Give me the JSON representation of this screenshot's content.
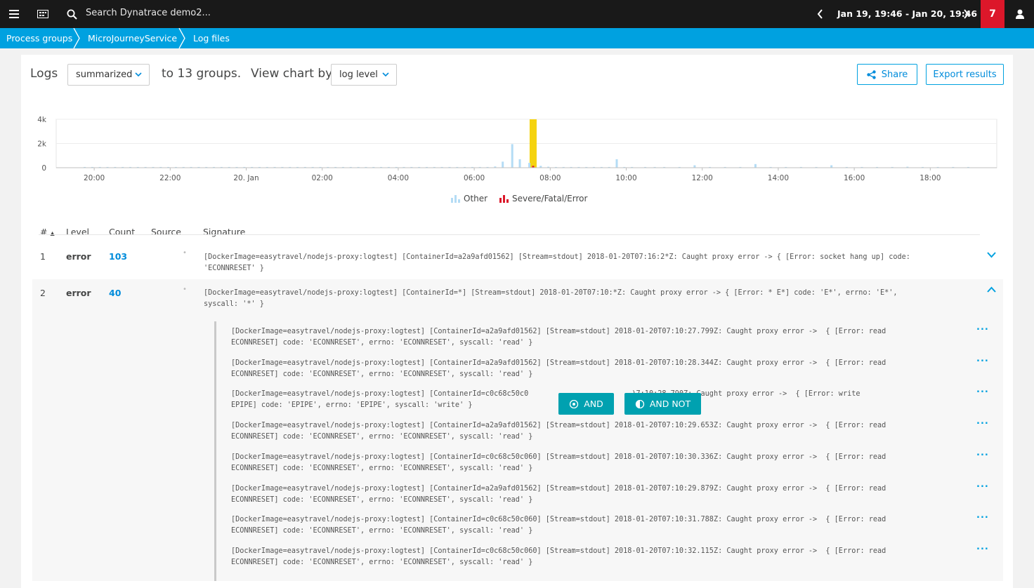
{
  "topbar": {
    "search_placeholder": "Search Dynatrace demo2...",
    "timeframe": "Jan 19, 19:46 - Jan 20, 19:46",
    "problems_count": "7"
  },
  "breadcrumb": [
    "Process groups",
    "MicroJourneyService",
    "Log files"
  ],
  "controls": {
    "logs_label": "Logs",
    "mode_select": "summarized",
    "groups_text": "to 13 groups.",
    "view_by_label": "View chart by",
    "view_by_select": "log level",
    "share_label": "Share",
    "export_label": "Export results"
  },
  "chart_data": {
    "type": "bar",
    "yticks": [
      "4k",
      "2k",
      "0"
    ],
    "ylim": [
      0,
      4000
    ],
    "xticks": [
      "20:00",
      "22:00",
      "20. Jan",
      "02:00",
      "04:00",
      "06:00",
      "08:00",
      "10:00",
      "12:00",
      "14:00",
      "16:00",
      "18:00"
    ],
    "x_hours": [
      19.75,
      19.95,
      20.15,
      20.35,
      20.55,
      20.75,
      20.95,
      21.15,
      21.35,
      21.55,
      21.75,
      21.95,
      22.15,
      22.35,
      22.55,
      22.75,
      22.95,
      23.15,
      23.35,
      23.55,
      23.75,
      23.95,
      24.15,
      24.35,
      24.55,
      24.75,
      24.95,
      25.15,
      25.35,
      25.55,
      25.75,
      25.95,
      26.15,
      26.35,
      26.55,
      26.75,
      26.95,
      27.15,
      27.35,
      27.55,
      27.75,
      27.95,
      28.15,
      28.35,
      28.55,
      28.75,
      28.95,
      29.15,
      29.35,
      29.55,
      29.75,
      29.95,
      30.15,
      30.35,
      30.55,
      30.75,
      31.0,
      31.2,
      31.45,
      31.55,
      31.75,
      31.95,
      32.15,
      32.35,
      32.55,
      32.75,
      32.95,
      33.15,
      33.35,
      33.55,
      33.75,
      33.95,
      34.15,
      34.5,
      34.75,
      35.0,
      35.4,
      35.8,
      36.2,
      36.6,
      37.0,
      37.4,
      37.8,
      38.2,
      38.6,
      39.0,
      39.4,
      39.8,
      40.2,
      40.6,
      41.0,
      41.4,
      41.8,
      42.2,
      42.6,
      43.0
    ],
    "series": [
      {
        "name": "Other",
        "color": "#b4dcf5",
        "values": [
          60,
          60,
          60,
          60,
          60,
          60,
          60,
          60,
          60,
          60,
          60,
          60,
          60,
          60,
          60,
          60,
          60,
          60,
          60,
          60,
          60,
          60,
          60,
          60,
          60,
          60,
          60,
          60,
          60,
          60,
          60,
          60,
          60,
          60,
          60,
          60,
          60,
          60,
          60,
          60,
          60,
          60,
          60,
          60,
          60,
          60,
          60,
          60,
          60,
          60,
          60,
          60,
          60,
          60,
          100,
          500,
          1950,
          700,
          400,
          0,
          150,
          80,
          60,
          60,
          60,
          60,
          60,
          60,
          60,
          60,
          700,
          60,
          60,
          60,
          60,
          60,
          60,
          200,
          60,
          60,
          60,
          300,
          60,
          60,
          60,
          60,
          200,
          60,
          60,
          60,
          60,
          80,
          60,
          60,
          60,
          60
        ]
      },
      {
        "name": "Severe/Fatal/Error",
        "color": "#dc172a",
        "values": [
          0,
          0,
          0,
          0,
          0,
          0,
          0,
          0,
          0,
          0,
          0,
          0,
          0,
          0,
          0,
          0,
          0,
          0,
          0,
          0,
          0,
          0,
          0,
          0,
          0,
          0,
          0,
          0,
          0,
          0,
          0,
          0,
          0,
          0,
          0,
          0,
          0,
          0,
          0,
          0,
          0,
          0,
          0,
          0,
          0,
          0,
          0,
          0,
          0,
          0,
          0,
          0,
          0,
          0,
          0,
          0,
          0,
          0,
          0,
          150,
          0,
          0,
          0,
          0,
          0,
          0,
          0,
          0,
          0,
          0,
          0,
          0,
          0,
          0,
          0,
          0,
          0,
          0,
          0,
          0,
          0,
          0,
          0,
          0,
          0,
          0,
          0,
          0,
          0,
          0,
          0,
          0,
          0,
          0,
          0,
          0
        ]
      }
    ],
    "highlight_x_hour": 31.55,
    "highlight_color": "#f5d30f",
    "x_domain_hours": [
      19.0,
      43.75
    ],
    "legend": [
      "Other",
      "Severe/Fatal/Error"
    ]
  },
  "table": {
    "headers": [
      "#",
      "Level",
      "Count",
      "Source",
      "Signature"
    ],
    "rows": [
      {
        "num": "1",
        "level": "error",
        "count": "103",
        "sig_line1": "[DockerImage=easytravel/nodejs-proxy:logtest] [ContainerId=a2a9afd01562] [Stream=stdout] 2018-01-20T07:16:2*Z: Caught proxy error -> { [Error: socket hang up] code:",
        "sig_line2": "'ECONNRESET' }"
      },
      {
        "num": "2",
        "level": "error",
        "count": "40",
        "sig_line1": "[DockerImage=easytravel/nodejs-proxy:logtest] [ContainerId=*] [Stream=stdout] 2018-01-20T07:10:*Z: Caught proxy error -> { [Error: * E*] code: 'E*', errno: 'E*',",
        "sig_line2": "syscall: '*' }"
      }
    ],
    "entries": [
      {
        "l1": "[DockerImage=easytravel/nodejs-proxy:logtest] [ContainerId=a2a9afd01562] [Stream=stdout] 2018-01-20T07:10:27.799Z: Caught proxy error ->  { [Error: read",
        "l2": "ECONNRESET] code: 'ECONNRESET', errno: 'ECONNRESET', syscall: 'read' }"
      },
      {
        "l1": "[DockerImage=easytravel/nodejs-proxy:logtest] [ContainerId=a2a9afd01562] [Stream=stdout] 2018-01-20T07:10:28.344Z: Caught proxy error ->  { [Error: read",
        "l2": "ECONNRESET] code: 'ECONNRESET', errno: 'ECONNRESET', syscall: 'read' }"
      },
      {
        "l1": "[DockerImage=easytravel/nodejs-proxy:logtest] [ContainerId=c0c68c50c0                        )7:10:28.790Z: Caught proxy error ->  { [Error: write",
        "l2": "EPIPE] code: 'EPIPE', errno: 'EPIPE', syscall: 'write' }"
      },
      {
        "l1": "[DockerImage=easytravel/nodejs-proxy:logtest] [ContainerId=a2a9afd01562] [Stream=stdout] 2018-01-20T07:10:29.653Z: Caught proxy error ->  { [Error: read",
        "l2": "ECONNRESET] code: 'ECONNRESET', errno: 'ECONNRESET', syscall: 'read' }"
      },
      {
        "l1": "[DockerImage=easytravel/nodejs-proxy:logtest] [ContainerId=c0c68c50c060] [Stream=stdout] 2018-01-20T07:10:30.336Z: Caught proxy error ->  { [Error: read",
        "l2": "ECONNRESET] code: 'ECONNRESET', errno: 'ECONNRESET', syscall: 'read' }"
      },
      {
        "l1": "[DockerImage=easytravel/nodejs-proxy:logtest] [ContainerId=a2a9afd01562] [Stream=stdout] 2018-01-20T07:10:29.879Z: Caught proxy error ->  { [Error: read",
        "l2": "ECONNRESET] code: 'ECONNRESET', errno: 'ECONNRESET', syscall: 'read' }"
      },
      {
        "l1": "[DockerImage=easytravel/nodejs-proxy:logtest] [ContainerId=c0c68c50c060] [Stream=stdout] 2018-01-20T07:10:31.788Z: Caught proxy error ->  { [Error: read",
        "l2": "ECONNRESET] code: 'ECONNRESET', errno: 'ECONNRESET', syscall: 'read' }"
      },
      {
        "l1": "[DockerImage=easytravel/nodejs-proxy:logtest] [ContainerId=c0c68c50c060] [Stream=stdout] 2018-01-20T07:10:32.115Z: Caught proxy error ->  { [Error: read",
        "l2": "ECONNRESET] code: 'ECONNRESET', errno: 'ECONNRESET', syscall: 'read' }"
      }
    ],
    "filter_and": "AND",
    "filter_and_not": "AND NOT",
    "more_label": "..."
  },
  "colors": {
    "accent": "#00a1e0",
    "topbar": "#191919",
    "problem": "#dc172a",
    "filter_btn": "#00a1b0"
  }
}
